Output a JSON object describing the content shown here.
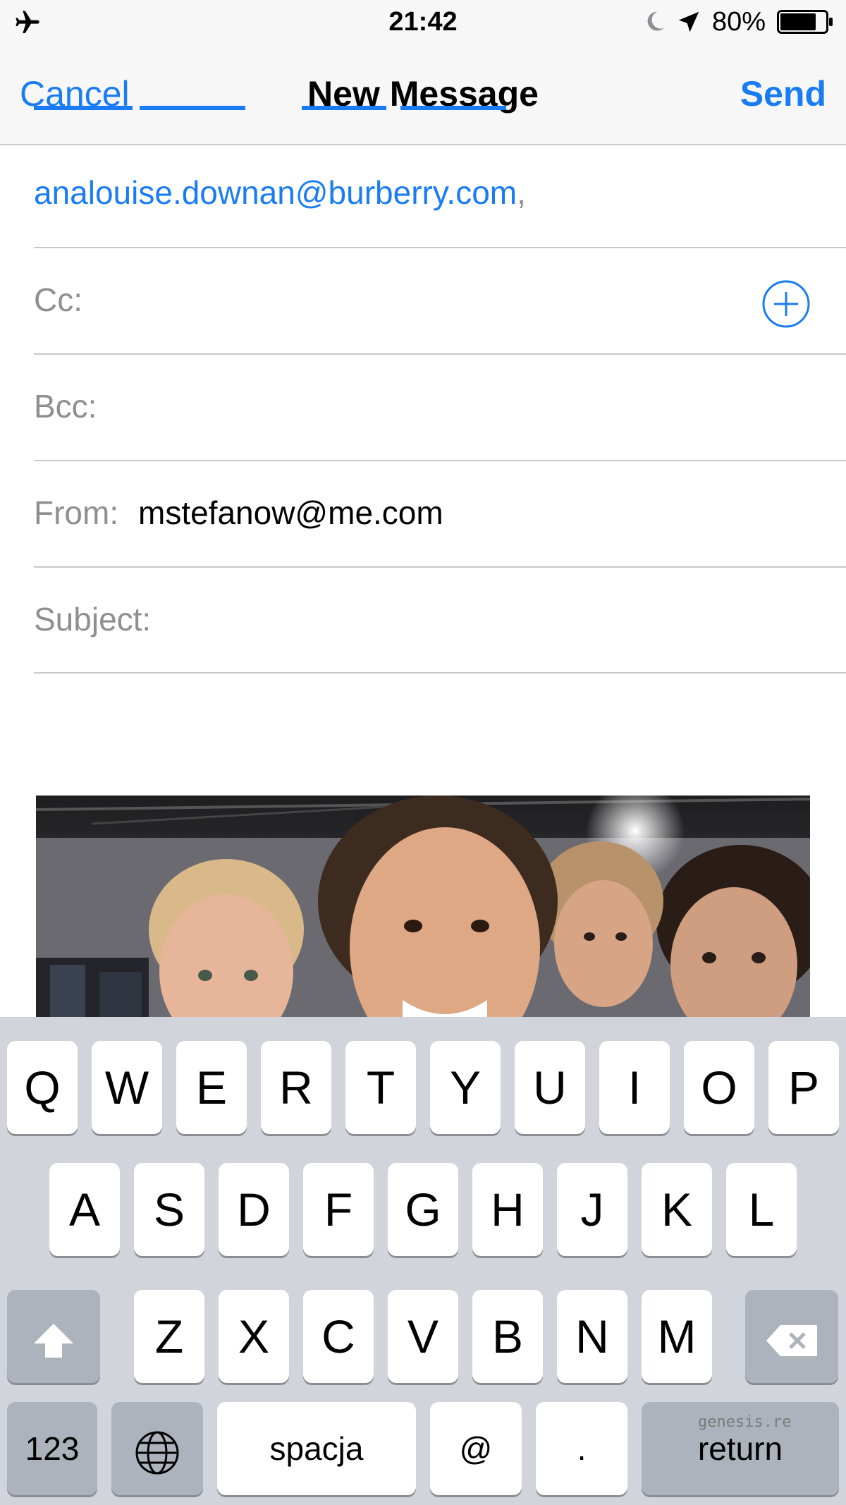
{
  "status_bar": {
    "time": "21:42",
    "battery_text": "80%",
    "battery_level": 0.8,
    "icons": [
      "airplane-icon",
      "moon-icon",
      "location-arrow-icon",
      "battery-icon"
    ]
  },
  "nav": {
    "cancel_label": "Cancel",
    "title": "New Message",
    "send_label": "Send"
  },
  "compose": {
    "to_recipient": "analouise.downan@burberry.com",
    "to_separator": ",",
    "cc_label": "Cc:",
    "bcc_label": "Bcc:",
    "from_label": "From:",
    "from_value": "mstefanow@me.com",
    "subject_label": "Subject:"
  },
  "keyboard": {
    "row1": [
      "Q",
      "W",
      "E",
      "R",
      "T",
      "Y",
      "U",
      "I",
      "O",
      "P"
    ],
    "row2": [
      "A",
      "S",
      "D",
      "F",
      "G",
      "H",
      "J",
      "K",
      "L"
    ],
    "row3": [
      "Z",
      "X",
      "C",
      "V",
      "B",
      "N",
      "M"
    ],
    "numbers_label": "123",
    "space_label": "spacja",
    "at_label": "@",
    "period_label": ".",
    "return_label": "return"
  },
  "watermark": "genesis.re",
  "colors": {
    "accent": "#1a7cf5",
    "separator": "#c8c7cc",
    "placeholder": "#8e8e93",
    "keyboard_bg": "#d1d5db"
  }
}
